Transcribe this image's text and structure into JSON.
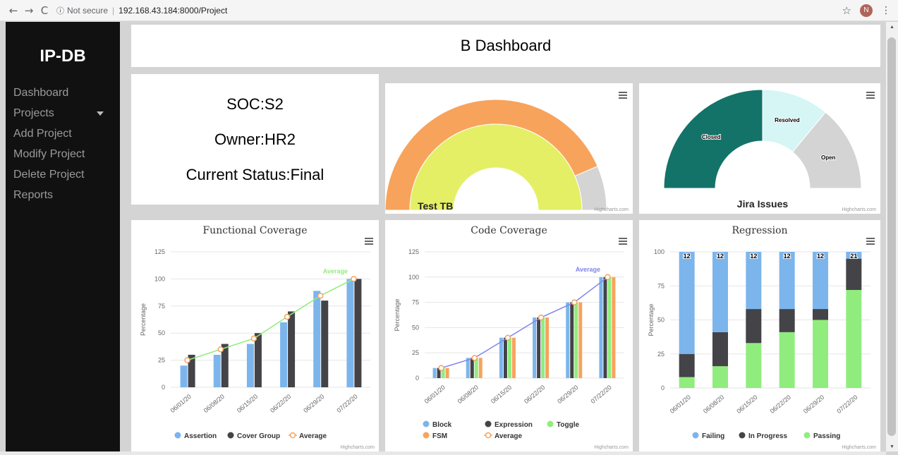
{
  "browser": {
    "back": "←",
    "forward": "→",
    "reload": "C",
    "info_icon": "ⓘ",
    "not_secure": "Not secure",
    "separator": "|",
    "url": "192.168.43.184:8000/Project",
    "star": "☆",
    "profile_initial": "N",
    "menu": "⋮"
  },
  "sidebar": {
    "brand": "IP-DB",
    "items": [
      {
        "label": "Dashboard"
      },
      {
        "label": "Projects",
        "has_caret": true
      },
      {
        "label": "Add Project"
      },
      {
        "label": "Modify Project"
      },
      {
        "label": "Delete Project"
      },
      {
        "label": "Reports"
      }
    ]
  },
  "header": {
    "title": "B Dashboard"
  },
  "project_info": {
    "soc": "SOC:S2",
    "owner": "Owner:HR2",
    "status": "Current Status:Final"
  },
  "credit": "Highcharts.com",
  "colors": {
    "sidebar_bg": "#111111",
    "blue": "#7cb5ec",
    "dark": "#434348",
    "green": "#90ed7d",
    "orange": "#f7a35c",
    "average_line": "#90ed7d",
    "code_average_line": "#8085e9",
    "gauge_orange": "#f7a35c",
    "gauge_yellow": "#e4ef65",
    "gauge_gray": "#d4d4d4",
    "jira_closed": "#137369",
    "jira_resolved": "#d6f5f5",
    "jira_open": "#d4d4d4"
  },
  "chart_data": [
    {
      "type": "pie",
      "id": "test-tb",
      "variant": "semi-donut",
      "title": "Test TB",
      "rings": [
        {
          "name": "outer",
          "values": [
            87,
            13
          ]
        },
        {
          "name": "inner",
          "values": [
            100
          ]
        }
      ]
    },
    {
      "type": "pie",
      "id": "jira",
      "variant": "semi-donut",
      "title": "Jira Issues",
      "slices": [
        {
          "name": "Closed",
          "value": 50
        },
        {
          "name": "Resolved",
          "value": 22
        },
        {
          "name": "Open",
          "value": 28
        }
      ]
    },
    {
      "type": "bar",
      "id": "functional",
      "title": "Functional Coverage",
      "ylabel": "Percentage",
      "ylim": [
        0,
        125
      ],
      "yticks": [
        0,
        25,
        50,
        75,
        100,
        125
      ],
      "categories": [
        "06/01/20",
        "06/08/20",
        "06/15/20",
        "06/22/20",
        "06/29/20",
        "07/22/20"
      ],
      "series": [
        {
          "name": "Assertion",
          "values": [
            20,
            30,
            40,
            60,
            89,
            100
          ]
        },
        {
          "name": "Cover Group",
          "values": [
            30,
            40,
            50,
            70,
            80,
            100
          ]
        }
      ],
      "line": {
        "name": "Average",
        "values": [
          25,
          35,
          45,
          65,
          84.5,
          100
        ]
      },
      "legend": [
        "Assertion",
        "Cover Group",
        "Average"
      ]
    },
    {
      "type": "bar",
      "id": "code",
      "title": "Code Coverage",
      "ylabel": "Percentage",
      "ylim": [
        0,
        125
      ],
      "yticks": [
        0,
        25,
        50,
        75,
        100,
        125
      ],
      "categories": [
        "06/01/20",
        "06/08/20",
        "06/15/20",
        "06/22/20",
        "06/29/20",
        "07/22/20"
      ],
      "series": [
        {
          "name": "Block",
          "values": [
            10,
            20,
            40,
            60,
            75,
            100
          ]
        },
        {
          "name": "Expression",
          "values": [
            10,
            20,
            40,
            60,
            75,
            100
          ]
        },
        {
          "name": "Toggle",
          "values": [
            10,
            20,
            40,
            60,
            75,
            100
          ]
        },
        {
          "name": "FSM",
          "values": [
            10,
            20,
            40,
            60,
            75,
            100
          ]
        }
      ],
      "line": {
        "name": "Average",
        "values": [
          10,
          20,
          40,
          60,
          75,
          100
        ]
      },
      "legend": [
        "Block",
        "Expression",
        "Toggle",
        "FSM",
        "Average"
      ]
    },
    {
      "type": "bar",
      "id": "regression",
      "variant": "stacked",
      "title": "Regression",
      "ylabel": "Percentage",
      "ylim": [
        0,
        100
      ],
      "yticks": [
        0,
        25,
        50,
        75,
        100
      ],
      "categories": [
        "06/01/20",
        "06/08/20",
        "06/15/20",
        "06/22/20",
        "06/29/20",
        "07/22/20"
      ],
      "series": [
        {
          "name": "Passing",
          "values": [
            8,
            16,
            33,
            41,
            50,
            72
          ]
        },
        {
          "name": "In Progress",
          "values": [
            17,
            25,
            25,
            17,
            8,
            23
          ]
        },
        {
          "name": "Failing",
          "values": [
            75,
            59,
            42,
            42,
            42,
            5
          ]
        }
      ],
      "totals": [
        "12",
        "12",
        "12",
        "12",
        "12",
        "21"
      ],
      "legend": [
        "Failing",
        "In Progress",
        "Passing"
      ]
    }
  ]
}
